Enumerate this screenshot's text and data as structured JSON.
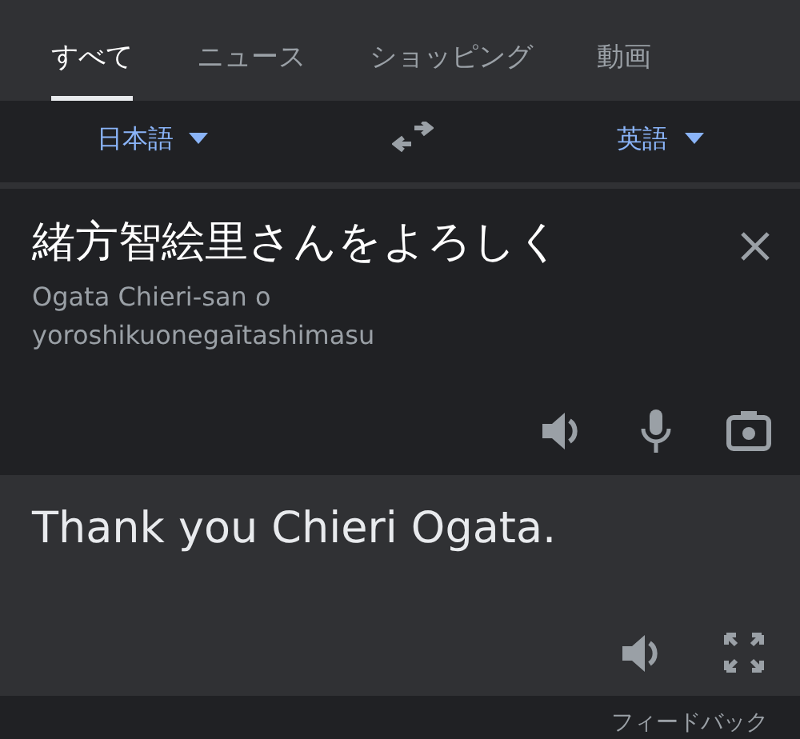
{
  "tabs": [
    {
      "label": "すべて",
      "selected": true
    },
    {
      "label": "ニュース",
      "selected": false
    },
    {
      "label": "ショッピング",
      "selected": false
    },
    {
      "label": "動画",
      "selected": false
    }
  ],
  "languages": {
    "source": "日本語",
    "target": "英語"
  },
  "source": {
    "text": "緒方智絵里さんをよろしく",
    "romanization": "Ogata Chieri-san o yoroshikuonegaītashimasu"
  },
  "translation": {
    "text": "Thank you Chieri Ogata."
  },
  "footer": {
    "link": "フィードバック"
  }
}
